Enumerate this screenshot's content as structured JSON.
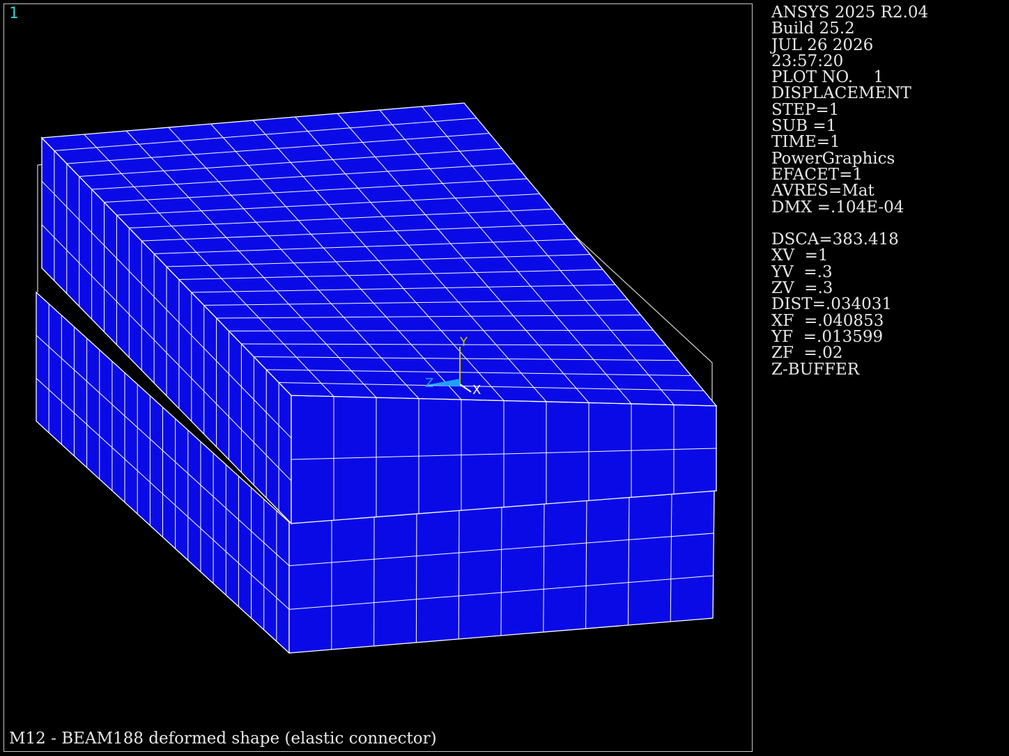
{
  "window_number": "1",
  "status_lines": [
    "ANSYS 2025 R2.04",
    "Build 25.2",
    "JUL 26 2026",
    "23:57:20",
    "PLOT NO.    1",
    "DISPLACEMENT",
    "STEP=1",
    "SUB =1",
    "TIME=1",
    "PowerGraphics",
    "EFACET=1",
    "AVRES=Mat",
    "DMX =.104E-04",
    "",
    "DSCA=383.418",
    "XV  =1",
    "YV  =.3",
    "ZV  =.3",
    "DIST=.034031",
    "XF  =.040853",
    "YF  =.013599",
    "ZF  =.02",
    "Z-BUFFER"
  ],
  "plot_title": "M12 - BEAM188 deformed shape (elastic connector)",
  "triad": {
    "x_label": "X",
    "y_label": "Y",
    "z_label": "Z"
  },
  "colors": {
    "background": "#000000",
    "element_fill": "#0a0ae6",
    "mesh_lines": "#ffffff",
    "undeformed_edge": "#d8d8d8",
    "window_number": "#2fd1d1",
    "text": "#e6e6e6",
    "triad_x": "#ffffff",
    "triad_y": "#c8c800",
    "triad_z": "#1ea0ff"
  }
}
